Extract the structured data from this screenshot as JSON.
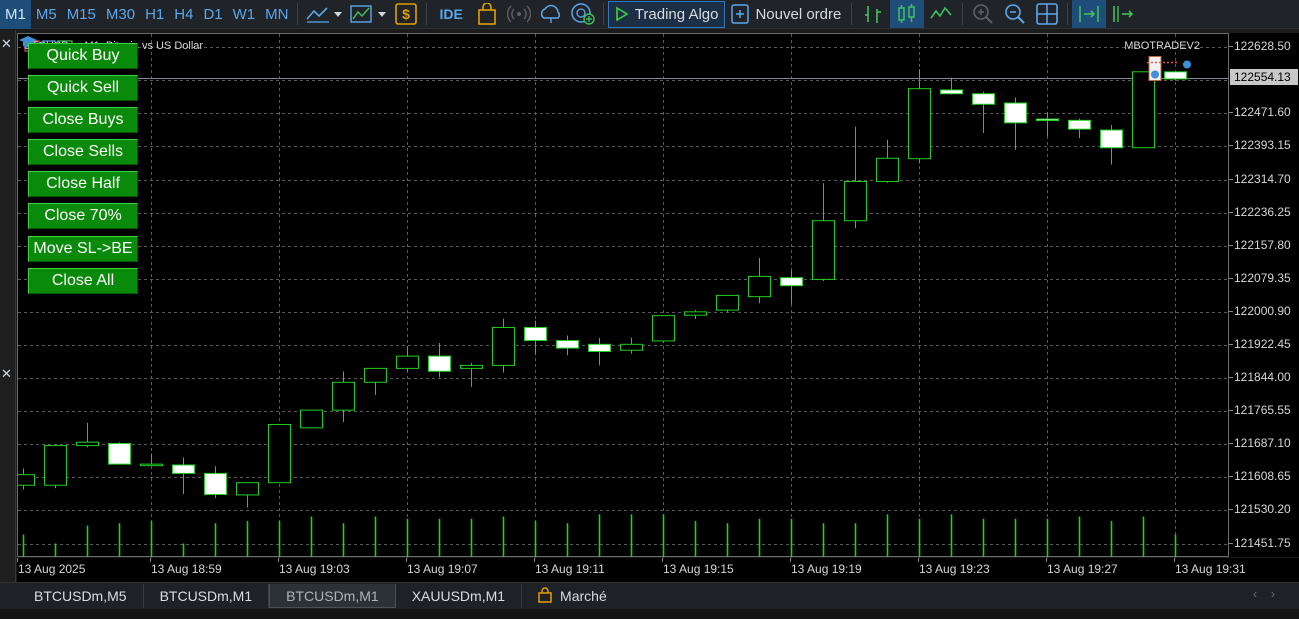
{
  "toolbar": {
    "timeframes": [
      "M1",
      "M5",
      "M15",
      "M30",
      "H1",
      "H4",
      "D1",
      "W1",
      "MN"
    ],
    "active_timeframe": "M1",
    "ide_label": "IDE",
    "algo_label": "Trading Algo",
    "new_order_label": "Nouvel ordre"
  },
  "chart": {
    "symbol_title": "BTCUSDm, M1:  Bitcoin vs US Dollar",
    "ea_label": "MBOTRADEV2",
    "current_price": "122554.13",
    "price_labels": [
      "122628.50",
      "122471.60",
      "122393.15",
      "122314.70",
      "122236.25",
      "122157.80",
      "122079.35",
      "122000.90",
      "121922.45",
      "121844.00",
      "121765.55",
      "121687.10",
      "121608.65",
      "121530.20",
      "121451.75"
    ],
    "time_labels": [
      "13 Aug 2025",
      "13 Aug 18:59",
      "13 Aug 19:03",
      "13 Aug 19:07",
      "13 Aug 19:11",
      "13 Aug 19:15",
      "13 Aug 19:19",
      "13 Aug 19:23",
      "13 Aug 19:27",
      "13 Aug 19:31"
    ],
    "colors": {
      "background": "#000000",
      "grid": "#5a5a5a",
      "bull_outline": "#1fcf1f",
      "bear_body": "#ffffff",
      "volume": "#1fcf1f",
      "current_line": "#7f8a94"
    }
  },
  "chart_data": {
    "type": "candlestick",
    "xlabel": "",
    "ylabel": "",
    "ylim": [
      121417.5,
      122659.6
    ],
    "price_grid": [
      122628.5,
      122550.05,
      122471.6,
      122393.15,
      122314.7,
      122236.25,
      122157.8,
      122079.35,
      122000.9,
      121922.45,
      121844.0,
      121765.55,
      121687.1,
      121608.65,
      121530.2,
      121451.75
    ],
    "current_price": 122554.13,
    "x_labels": [
      "13 Aug 2025",
      "13 Aug 18:59",
      "13 Aug 19:03",
      "13 Aug 19:07",
      "13 Aug 19:11",
      "13 Aug 19:15",
      "13 Aug 19:19",
      "13 Aug 19:23",
      "13 Aug 19:27",
      "13 Aug 19:31"
    ],
    "candles": [
      {
        "o": 121590,
        "h": 121630,
        "l": 121580,
        "c": 121615
      },
      {
        "o": 121590,
        "h": 121684,
        "l": 121583,
        "c": 121684
      },
      {
        "o": 121684,
        "h": 121738,
        "l": 121680,
        "c": 121692
      },
      {
        "o": 121689,
        "h": 121692,
        "l": 121639,
        "c": 121640
      },
      {
        "o": 121640,
        "h": 121665,
        "l": 121638,
        "c": 121640
      },
      {
        "o": 121638,
        "h": 121656,
        "l": 121569,
        "c": 121618
      },
      {
        "o": 121618,
        "h": 121635,
        "l": 121560,
        "c": 121568
      },
      {
        "o": 121567,
        "h": 121595,
        "l": 121537,
        "c": 121596
      },
      {
        "o": 121596,
        "h": 121734,
        "l": 121595,
        "c": 121734
      },
      {
        "o": 121726,
        "h": 121768,
        "l": 121726,
        "c": 121768
      },
      {
        "o": 121768,
        "h": 121860,
        "l": 121740,
        "c": 121834
      },
      {
        "o": 121834,
        "h": 121866,
        "l": 121804,
        "c": 121867
      },
      {
        "o": 121867,
        "h": 121920,
        "l": 121860,
        "c": 121896
      },
      {
        "o": 121896,
        "h": 121927,
        "l": 121846,
        "c": 121860
      },
      {
        "o": 121867,
        "h": 121880,
        "l": 121823,
        "c": 121874
      },
      {
        "o": 121874,
        "h": 121985,
        "l": 121857,
        "c": 121964
      },
      {
        "o": 121964,
        "h": 121980,
        "l": 121900,
        "c": 121933
      },
      {
        "o": 121933,
        "h": 121945,
        "l": 121898,
        "c": 121915
      },
      {
        "o": 121924,
        "h": 121939,
        "l": 121874,
        "c": 121907
      },
      {
        "o": 121910,
        "h": 121940,
        "l": 121902,
        "c": 121924
      },
      {
        "o": 121932,
        "h": 121970,
        "l": 121927,
        "c": 121992
      },
      {
        "o": 121993,
        "h": 122005,
        "l": 121984,
        "c": 122001
      },
      {
        "o": 122005,
        "h": 122037,
        "l": 122000,
        "c": 122040
      },
      {
        "o": 122037,
        "h": 122129,
        "l": 122021,
        "c": 122085
      },
      {
        "o": 122082,
        "h": 122099,
        "l": 122020,
        "c": 122063
      },
      {
        "o": 122078,
        "h": 122306,
        "l": 122074,
        "c": 122217
      },
      {
        "o": 122217,
        "h": 122440,
        "l": 122199,
        "c": 122310
      },
      {
        "o": 122310,
        "h": 122409,
        "l": 122307,
        "c": 122365
      },
      {
        "o": 122364,
        "h": 122576,
        "l": 122353,
        "c": 122530
      },
      {
        "o": 122527,
        "h": 122556,
        "l": 122516,
        "c": 122518
      },
      {
        "o": 122518,
        "h": 122523,
        "l": 122425,
        "c": 122493
      },
      {
        "o": 122496,
        "h": 122509,
        "l": 122385,
        "c": 122449
      },
      {
        "o": 122458,
        "h": 122474,
        "l": 122417,
        "c": 122455
      },
      {
        "o": 122455,
        "h": 122459,
        "l": 122413,
        "c": 122434
      },
      {
        "o": 122432,
        "h": 122444,
        "l": 122350,
        "c": 122390
      },
      {
        "o": 122390,
        "h": 122570,
        "l": 122390,
        "c": 122570
      },
      {
        "o": 122570,
        "h": 122570,
        "l": 122549,
        "c": 122553
      }
    ],
    "volumes": [
      0.5,
      0.3,
      0.7,
      0.75,
      0.8,
      0.3,
      0.75,
      0.8,
      0.8,
      0.9,
      0.75,
      0.9,
      0.85,
      0.85,
      0.85,
      0.9,
      0.8,
      0.75,
      0.95,
      0.95,
      0.95,
      0.8,
      0.75,
      0.85,
      0.85,
      0.75,
      0.75,
      0.95,
      0.85,
      0.95,
      0.85,
      0.85,
      0.85,
      0.9,
      0.8,
      0.9,
      0.5
    ]
  },
  "panel": {
    "buttons": [
      "Quick Buy",
      "Quick Sell",
      "Close Buys",
      "Close Sells",
      "Close Half",
      "Close 70%",
      "Move SL->BE",
      "Close All"
    ]
  },
  "tabs": [
    "BTCUSDm,M5",
    "BTCUSDm,M1",
    "BTCUSDm,M1",
    "XAUUSDm,M1",
    "Marché"
  ],
  "active_tab_index": 2
}
